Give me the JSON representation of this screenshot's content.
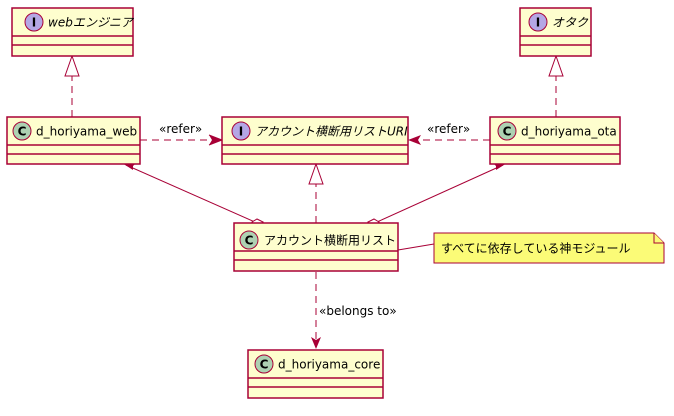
{
  "diagram": {
    "interfaces": {
      "web_engineer": {
        "name": "webエンジニア",
        "stereotype": "I"
      },
      "otaku": {
        "name": "オタク",
        "stereotype": "I"
      },
      "account_uri": {
        "name": "アカウント横断用リストURI",
        "stereotype": "I"
      }
    },
    "classes": {
      "d_horiyama_web": {
        "name": "d_horiyama_web",
        "stereotype": "C"
      },
      "d_horiyama_ota": {
        "name": "d_horiyama_ota",
        "stereotype": "C"
      },
      "account_list": {
        "name": "アカウント横断用リスト",
        "stereotype": "C"
      },
      "d_horiyama_core": {
        "name": "d_horiyama_core",
        "stereotype": "C"
      }
    },
    "relations": {
      "refer_left": "«refer»",
      "refer_right": "«refer»",
      "belongs_to": "«belongs to»"
    },
    "note": {
      "text": "すべてに依存している神モジュール"
    },
    "colors": {
      "box_fill": "#fefece",
      "box_border": "#a80036",
      "interface_circle": "#b4a7e5",
      "class_circle": "#add1b2",
      "note_fill": "#fbfb77",
      "note_border": "#a80036"
    }
  }
}
